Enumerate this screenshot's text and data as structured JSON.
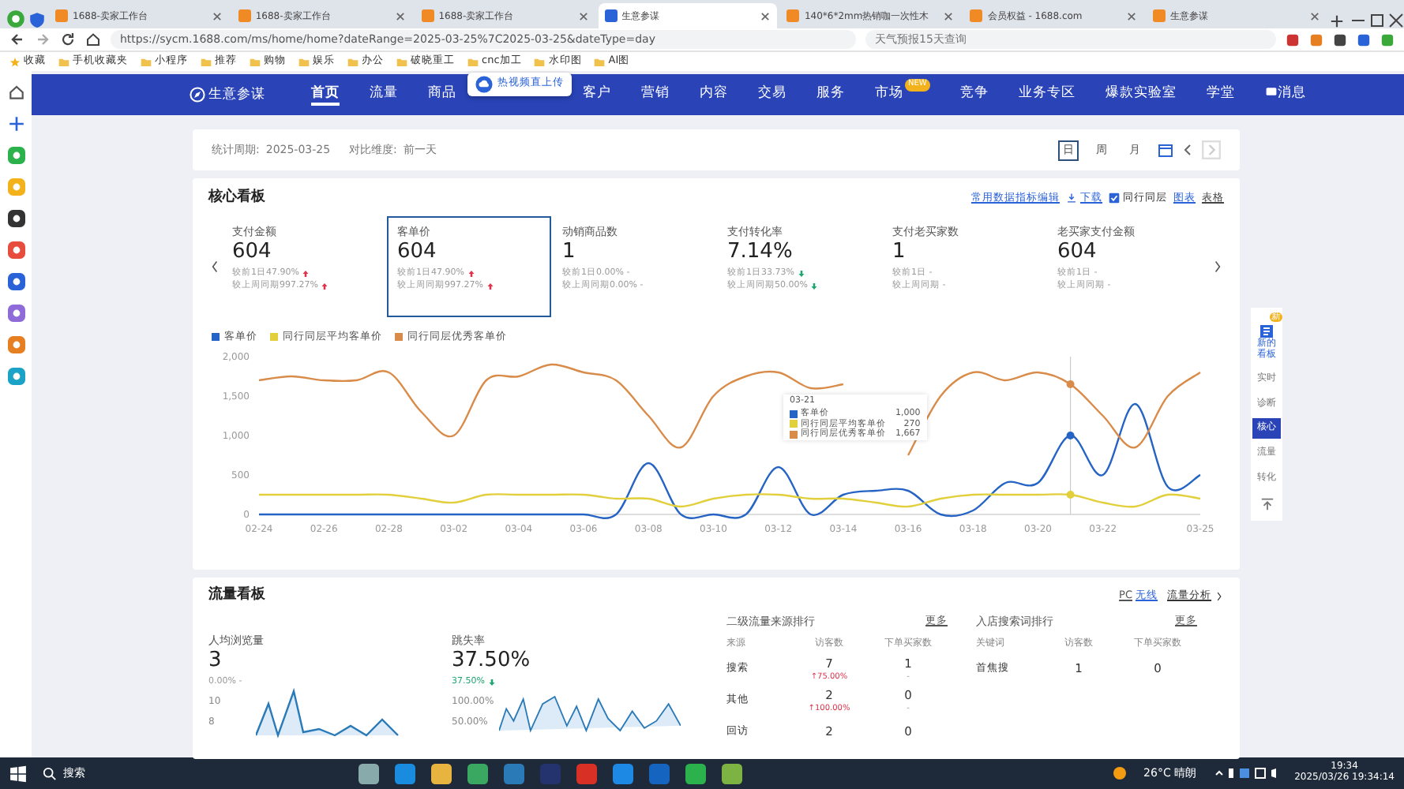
{
  "browser": {
    "tabs": [
      {
        "title": "1688-卖家工作台",
        "selected": false
      },
      {
        "title": "1688-卖家工作台",
        "selected": false
      },
      {
        "title": "1688-卖家工作台",
        "selected": false
      },
      {
        "title": "生意参谋",
        "selected": true
      },
      {
        "title": "140*6*2mm热销咖一次性木",
        "selected": false
      },
      {
        "title": "会员权益 - 1688.com",
        "selected": false
      },
      {
        "title": "生意参谋",
        "selected": false
      }
    ],
    "address": "https://sycm.1688.com/ms/home/home?dateRange=2025-03-25%7C2025-03-25&dateType=day",
    "search_placeholder": "天气预报15天查询",
    "bookmarks": [
      "收藏",
      "手机收藏夹",
      "小程序",
      "推荐",
      "购物",
      "娱乐",
      "办公",
      "破晓重工",
      "cnc加工",
      "水印图",
      "AI图"
    ]
  },
  "nav": {
    "brand": "生意参谋",
    "items": [
      {
        "kind": "tab",
        "label": "首页",
        "selected": true
      },
      {
        "kind": "tab",
        "label": "流量",
        "selected": false
      },
      {
        "kind": "tab",
        "label": "商品",
        "selected": false
      },
      {
        "kind": "popup",
        "label": "热视频直上传"
      },
      {
        "kind": "tab",
        "label": "客户",
        "selected": false
      },
      {
        "kind": "tab",
        "label": "营销",
        "selected": false
      },
      {
        "kind": "tab",
        "label": "内容",
        "selected": false
      },
      {
        "kind": "tab",
        "label": "交易",
        "selected": false
      },
      {
        "kind": "tab",
        "label": "服务",
        "selected": false
      },
      {
        "kind": "tab",
        "label": "市场",
        "selected": false,
        "badge": "NEW"
      },
      {
        "kind": "tab",
        "label": "竞争",
        "selected": false
      },
      {
        "kind": "tab",
        "label": "业务专区",
        "selected": false
      },
      {
        "kind": "tab",
        "label": "爆款实验室",
        "selected": false
      },
      {
        "kind": "tab",
        "label": "学堂",
        "selected": false
      },
      {
        "kind": "message",
        "label": "消息",
        "selected": false
      }
    ]
  },
  "period": {
    "label": "统计周期:",
    "date": "2025-03-25",
    "compare_label": "对比维度:",
    "compare": "前一天",
    "ranges": [
      {
        "label": "日",
        "selected": true
      },
      {
        "label": "周",
        "selected": false
      },
      {
        "label": "月",
        "selected": false
      }
    ]
  },
  "core": {
    "title": "核心看板",
    "links": [
      "常用数据指标编辑",
      "下载"
    ],
    "peer": {
      "label": "同行同层",
      "checked": true
    },
    "views": [
      {
        "label": "图表",
        "selected": true
      },
      {
        "label": "表格",
        "selected": false
      }
    ],
    "metrics": [
      {
        "name": "支付金额",
        "value": "604",
        "selected": false,
        "rows": [
          {
            "text": "较前1日47.90%",
            "kind": "up"
          },
          {
            "text": "较上周同期997.27%",
            "kind": "up"
          }
        ]
      },
      {
        "name": "客单价",
        "value": "604",
        "selected": true,
        "rows": [
          {
            "text": "较前1日47.90%",
            "kind": "up"
          },
          {
            "text": "较上周同期997.27%",
            "kind": "up"
          }
        ]
      },
      {
        "name": "动销商品数",
        "value": "1",
        "selected": false,
        "rows": [
          {
            "text": "较前1日0.00% -",
            "kind": "flat"
          },
          {
            "text": "较上周同期0.00% -",
            "kind": "flat"
          }
        ]
      },
      {
        "name": "支付转化率",
        "value": "7.14%",
        "selected": false,
        "rows": [
          {
            "text": "较前1日33.73%",
            "kind": "down"
          },
          {
            "text": "较上周同期50.00%",
            "kind": "down"
          }
        ]
      },
      {
        "name": "支付老买家数",
        "value": "1",
        "selected": false,
        "rows": [
          {
            "text": "较前1日 -",
            "kind": "flat"
          },
          {
            "text": "较上周同期 -",
            "kind": "flat"
          }
        ]
      },
      {
        "name": "老买家支付金额",
        "value": "604",
        "selected": false,
        "rows": [
          {
            "text": "较前1日 -",
            "kind": "flat"
          },
          {
            "text": "较上周同期 -",
            "kind": "flat"
          }
        ]
      }
    ],
    "chart_data": {
      "type": "line",
      "categories": [
        "02-24",
        null,
        "02-26",
        null,
        "02-28",
        null,
        "03-02",
        null,
        "03-04",
        null,
        "03-06",
        null,
        "03-08",
        null,
        "03-10",
        null,
        "03-12",
        null,
        "03-14",
        null,
        "03-16",
        null,
        "03-18",
        null,
        "03-20",
        null,
        "03-22",
        null,
        null,
        "03-25"
      ],
      "yticks": [
        {
          "value": 0,
          "label": "0"
        },
        {
          "value": 500,
          "label": "500"
        },
        {
          "value": 1000,
          "label": "1,000"
        },
        {
          "value": 1500,
          "label": "1,500"
        },
        {
          "value": 2000,
          "label": "2,000"
        }
      ],
      "ylim": [
        0,
        2000
      ],
      "series": [
        {
          "name": "客单价",
          "color": "#2563c4",
          "values": [
            0,
            0,
            0,
            0,
            0,
            0,
            0,
            0,
            0,
            0,
            0,
            0,
            650,
            0,
            0,
            0,
            600,
            0,
            250,
            300,
            300,
            0,
            50,
            400,
            400,
            1000,
            500,
            1400,
            350,
            500
          ]
        },
        {
          "name": "同行同层平均客单价",
          "color": "#e2cf3c",
          "values": [
            250,
            250,
            250,
            250,
            250,
            200,
            150,
            250,
            250,
            250,
            250,
            200,
            200,
            100,
            200,
            250,
            250,
            200,
            200,
            150,
            100,
            200,
            250,
            250,
            250,
            250,
            150,
            100,
            250,
            200
          ]
        },
        {
          "name": "同行同层优秀客单价",
          "color": "#d98c4a",
          "values": [
            1700,
            1750,
            1700,
            1700,
            1800,
            1300,
            1000,
            1700,
            1750,
            1900,
            1800,
            1700,
            1250,
            850,
            1500,
            1750,
            1800,
            1600,
            1650,
            null,
            750,
            1500,
            1800,
            1700,
            1800,
            1650,
            1250,
            850,
            1500,
            1800
          ]
        }
      ]
    },
    "tooltip": {
      "date": "03-21",
      "rows": [
        {
          "label": "客单价",
          "value": "1,000"
        },
        {
          "label": "同行同层平均客单价",
          "value": "270"
        },
        {
          "label": "同行同层优秀客单价",
          "value": "1,667"
        }
      ]
    }
  },
  "traffic": {
    "title": "流量看板",
    "terminals": [
      {
        "label": "PC",
        "selected": false
      },
      {
        "label": "无线",
        "selected": true
      }
    ],
    "analysis": "流量分析",
    "metrics": [
      {
        "name": "人均浏览量",
        "value": "3",
        "change": "0.00% -",
        "kind": "flat",
        "axis": [
          "10",
          "8"
        ]
      },
      {
        "name": "跳失率",
        "value": "37.50%",
        "change": "37.50%",
        "kind": "down",
        "axis": [
          "100.00%",
          "50.00%"
        ]
      }
    ],
    "tables": [
      {
        "title": "二级流量来源排行",
        "more": "更多",
        "columns": [
          "来源",
          "访客数",
          "下单买家数"
        ],
        "rows": [
          {
            "cells": [
              "搜索",
              "7",
              "1"
            ],
            "notes": [
              "↑75.00%",
              "-"
            ]
          },
          {
            "cells": [
              "其他",
              "2",
              "0"
            ],
            "notes": [
              "↑100.00%",
              "-"
            ]
          },
          {
            "cells": [
              "回访",
              "2",
              "0"
            ]
          }
        ]
      },
      {
        "title": "入店搜索词排行",
        "more": "更多",
        "columns": [
          "关键词",
          "访客数",
          "下单买家数"
        ],
        "rows": [
          {
            "cells": [
              "首焦搜",
              "1",
              "0"
            ]
          }
        ]
      }
    ]
  },
  "dock": [
    {
      "label": "新的看板",
      "kind": "new",
      "badge": "新"
    },
    {
      "label": "实时",
      "kind": "item",
      "selected": false
    },
    {
      "label": "诊断",
      "kind": "item",
      "selected": false
    },
    {
      "label": "核心",
      "kind": "item",
      "selected": true
    },
    {
      "label": "流量",
      "kind": "item",
      "selected": false
    },
    {
      "label": "转化",
      "kind": "item",
      "selected": false
    },
    {
      "kind": "top"
    }
  ],
  "taskbar": {
    "search": "搜索",
    "weather": "26°C 晴朗",
    "time": "19:34",
    "date": "2025/03/26 19:34:14"
  }
}
